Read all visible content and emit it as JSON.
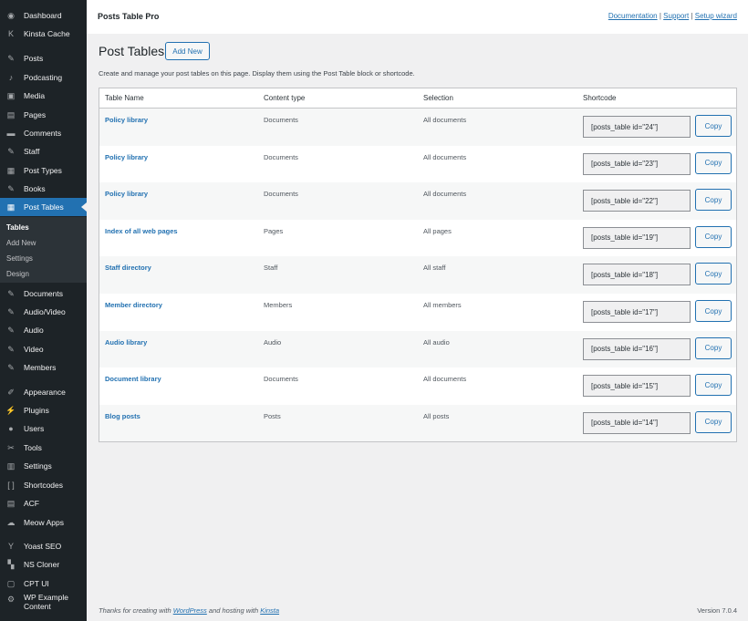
{
  "sidebar": {
    "items": [
      {
        "label": "Dashboard",
        "icon": "dashboard-icon",
        "glyph": "◉"
      },
      {
        "label": "Kinsta Cache",
        "icon": "kinsta-icon",
        "glyph": "K"
      },
      {
        "label": "Posts",
        "icon": "pin-icon",
        "glyph": "✎"
      },
      {
        "label": "Podcasting",
        "icon": "microphone-icon",
        "glyph": "♪"
      },
      {
        "label": "Media",
        "icon": "media-icon",
        "glyph": "▣"
      },
      {
        "label": "Pages",
        "icon": "pages-icon",
        "glyph": "▤"
      },
      {
        "label": "Comments",
        "icon": "comment-icon",
        "glyph": "▬"
      },
      {
        "label": "Staff",
        "icon": "pin-icon",
        "glyph": "✎"
      },
      {
        "label": "Post Types",
        "icon": "post-types-icon",
        "glyph": "▦"
      },
      {
        "label": "Books",
        "icon": "pin-icon",
        "glyph": "✎"
      },
      {
        "label": "Post Tables",
        "icon": "table-icon",
        "glyph": "▦"
      },
      {
        "label": "Documents",
        "icon": "pin-icon",
        "glyph": "✎"
      },
      {
        "label": "Audio/Video",
        "icon": "pin-icon",
        "glyph": "✎"
      },
      {
        "label": "Audio",
        "icon": "pin-icon",
        "glyph": "✎"
      },
      {
        "label": "Video",
        "icon": "pin-icon",
        "glyph": "✎"
      },
      {
        "label": "Members",
        "icon": "pin-icon",
        "glyph": "✎"
      },
      {
        "label": "Appearance",
        "icon": "brush-icon",
        "glyph": "✐"
      },
      {
        "label": "Plugins",
        "icon": "plugin-icon",
        "glyph": "⚡"
      },
      {
        "label": "Users",
        "icon": "user-icon",
        "glyph": "●"
      },
      {
        "label": "Tools",
        "icon": "wrench-icon",
        "glyph": "✂"
      },
      {
        "label": "Settings",
        "icon": "settings-icon",
        "glyph": "▥"
      },
      {
        "label": "Shortcodes",
        "icon": "brackets-icon",
        "glyph": "[ ]"
      },
      {
        "label": "ACF",
        "icon": "acf-icon",
        "glyph": "▤"
      },
      {
        "label": "Meow Apps",
        "icon": "meow-icon",
        "glyph": "☁"
      },
      {
        "label": "Yoast SEO",
        "icon": "yoast-icon",
        "glyph": "Y"
      },
      {
        "label": "NS Cloner",
        "icon": "cloner-icon",
        "glyph": "▚"
      },
      {
        "label": "CPT UI",
        "icon": "cpt-icon",
        "glyph": "▢"
      },
      {
        "label": "WP Example",
        "label2": "Content",
        "icon": "gear-icon",
        "glyph": "⚙"
      }
    ],
    "submenu": [
      "Tables",
      "Add New",
      "Settings",
      "Design"
    ]
  },
  "topbar": {
    "title": "Posts Table Pro",
    "links": [
      "Documentation",
      "Support",
      "Setup wizard"
    ],
    "separator": "|"
  },
  "page": {
    "title": "Post Tables",
    "add_new": "Add New",
    "description": "Create and manage your post tables on this page. Display them using the Post Table block or shortcode."
  },
  "table": {
    "headers": [
      "Table Name",
      "Content type",
      "Selection",
      "Shortcode"
    ],
    "copy_label": "Copy",
    "rows": [
      {
        "name": "Policy library",
        "type": "Documents",
        "selection": "All documents",
        "shortcode": "[posts_table id=\"24\"]"
      },
      {
        "name": "Policy library",
        "type": "Documents",
        "selection": "All documents",
        "shortcode": "[posts_table id=\"23\"]"
      },
      {
        "name": "Policy library",
        "type": "Documents",
        "selection": "All documents",
        "shortcode": "[posts_table id=\"22\"]"
      },
      {
        "name": "Index of all web pages",
        "type": "Pages",
        "selection": "All pages",
        "shortcode": "[posts_table id=\"19\"]"
      },
      {
        "name": "Staff directory",
        "type": "Staff",
        "selection": "All staff",
        "shortcode": "[posts_table id=\"18\"]"
      },
      {
        "name": "Member directory",
        "type": "Members",
        "selection": "All members",
        "shortcode": "[posts_table id=\"17\"]"
      },
      {
        "name": "Audio library",
        "type": "Audio",
        "selection": "All audio",
        "shortcode": "[posts_table id=\"16\"]"
      },
      {
        "name": "Document library",
        "type": "Documents",
        "selection": "All documents",
        "shortcode": "[posts_table id=\"15\"]"
      },
      {
        "name": "Blog posts",
        "type": "Posts",
        "selection": "All posts",
        "shortcode": "[posts_table id=\"14\"]"
      }
    ]
  },
  "footer": {
    "prefix": "Thanks for creating with",
    "wordpress": "WordPress",
    "middle": "and hosting with",
    "kinsta": "Kinsta",
    "version": "Version 7.0.4"
  }
}
